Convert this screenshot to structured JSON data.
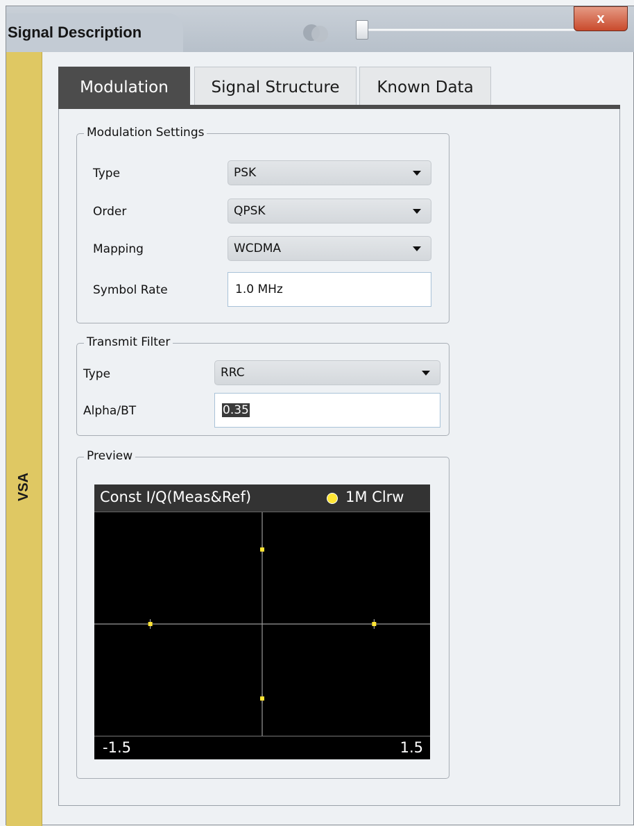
{
  "window": {
    "title": "Signal Description",
    "close_label": "x"
  },
  "side_strip": {
    "label": "VSA",
    "color": "#dfc863"
  },
  "tabs": [
    {
      "label": "Modulation",
      "active": true
    },
    {
      "label": "Signal Structure",
      "active": false
    },
    {
      "label": "Known Data",
      "active": false
    }
  ],
  "modulation_settings": {
    "legend": "Modulation Settings",
    "type_label": "Type",
    "type_value": "PSK",
    "order_label": "Order",
    "order_value": "QPSK",
    "mapping_label": "Mapping",
    "mapping_value": "WCDMA",
    "symbol_rate_label": "Symbol Rate",
    "symbol_rate_value": "1.0 MHz"
  },
  "transmit_filter": {
    "legend": "Transmit Filter",
    "type_label": "Type",
    "type_value": "RRC",
    "alpha_label": "Alpha/BT",
    "alpha_value": "0.35"
  },
  "preview": {
    "legend": "Preview",
    "plot_title": "Const I/Q(Meas&Ref)",
    "trace_label": "1M Clrw",
    "trace_color": "#ffe534",
    "axis_min": "-1.5",
    "axis_max": "1.5"
  },
  "chart_data": {
    "type": "scatter",
    "title": "Const I/Q(Meas&Ref)",
    "xlim": [
      -1.5,
      1.5
    ],
    "ylim": [
      -1.5,
      1.5
    ],
    "series": [
      {
        "name": "1M Clrw",
        "points": [
          [
            -1.0,
            0.0
          ],
          [
            1.0,
            0.0
          ],
          [
            0.0,
            1.0
          ],
          [
            0.0,
            -1.0
          ]
        ]
      }
    ]
  }
}
